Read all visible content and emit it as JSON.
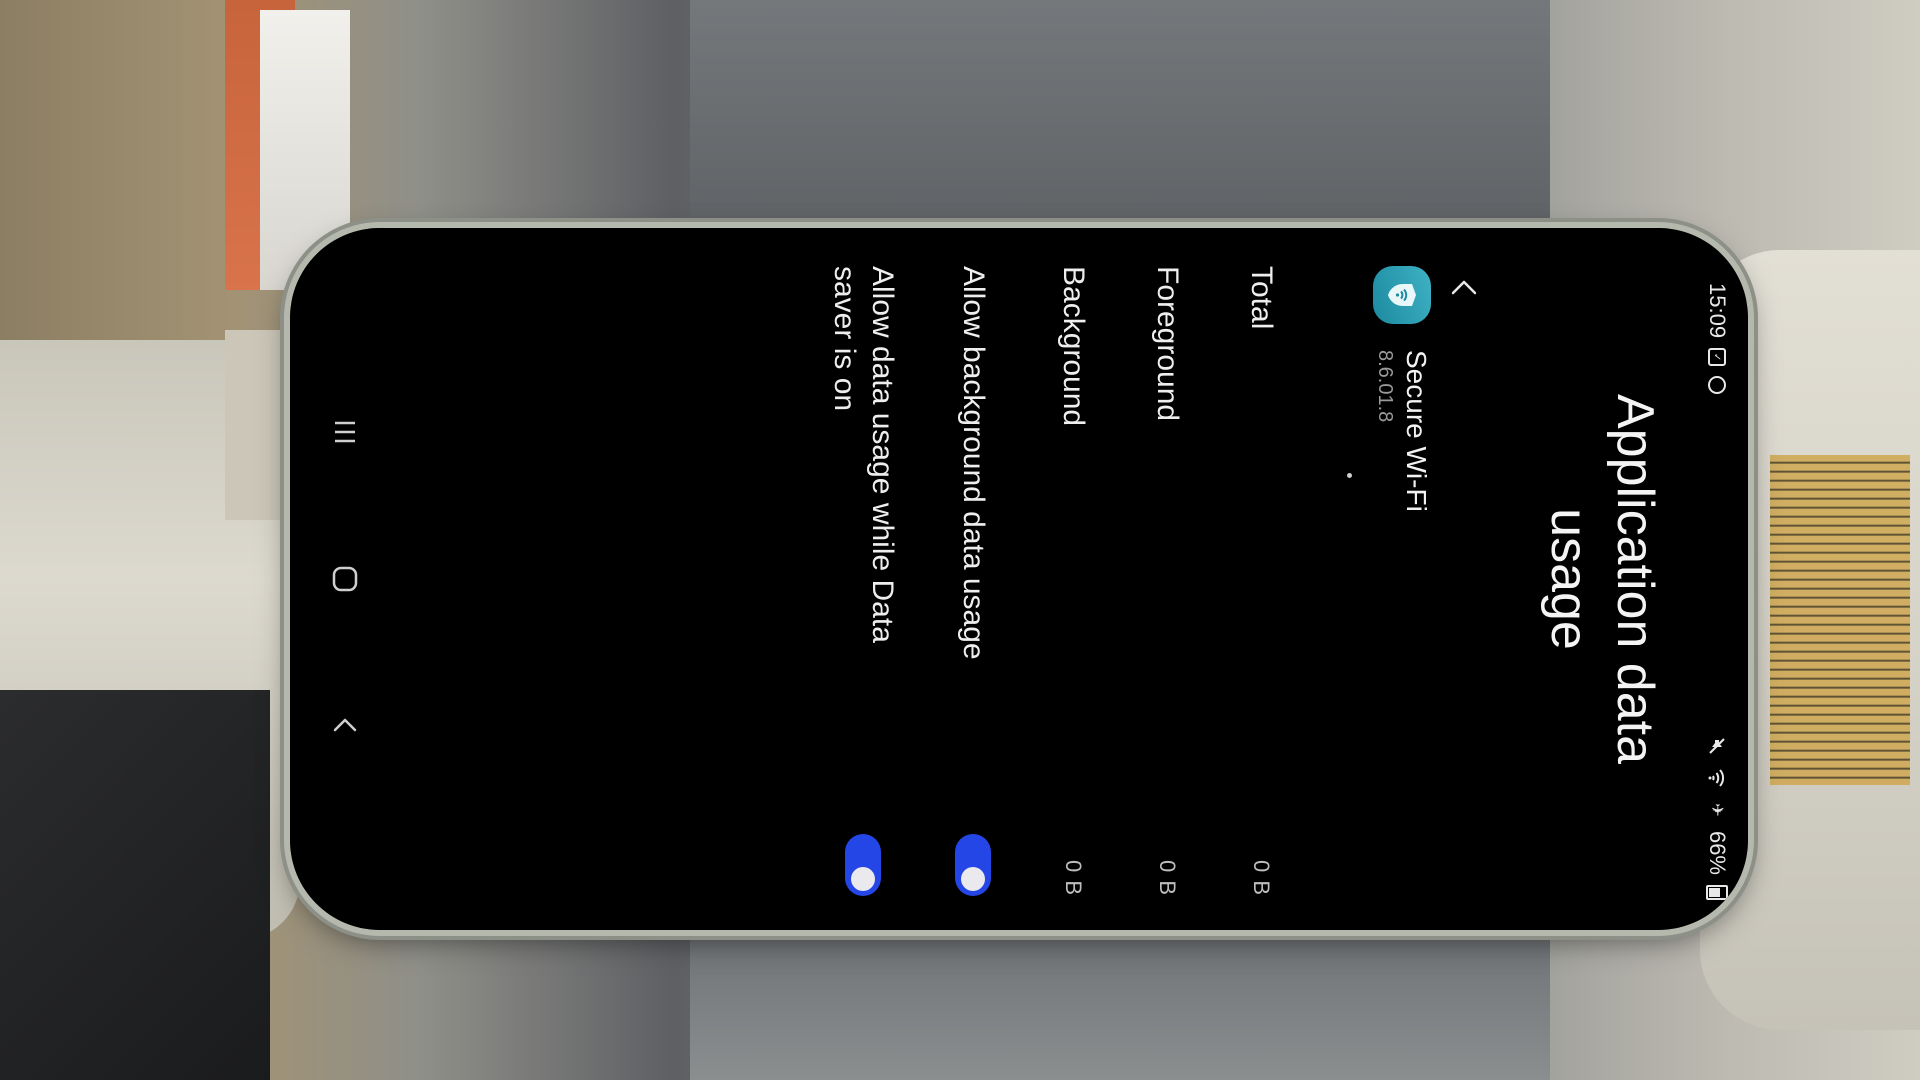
{
  "status_bar": {
    "time": "15:09",
    "battery_level": "66%"
  },
  "page": {
    "title": "Application data usage"
  },
  "app": {
    "name": "Secure Wi-Fi",
    "version": "8.6.01.8"
  },
  "usage": [
    {
      "label": "Total",
      "value": "0 B"
    },
    {
      "label": "Foreground",
      "value": "0 B"
    },
    {
      "label": "Background",
      "value": "0 B"
    }
  ],
  "toggles": [
    {
      "label": "Allow background data usage",
      "on": true
    },
    {
      "label": "Allow data usage while Data saver is on",
      "on": true
    }
  ],
  "colors": {
    "accent": "#2546e6",
    "background": "#000000",
    "app_icon": "#27a0b4"
  }
}
